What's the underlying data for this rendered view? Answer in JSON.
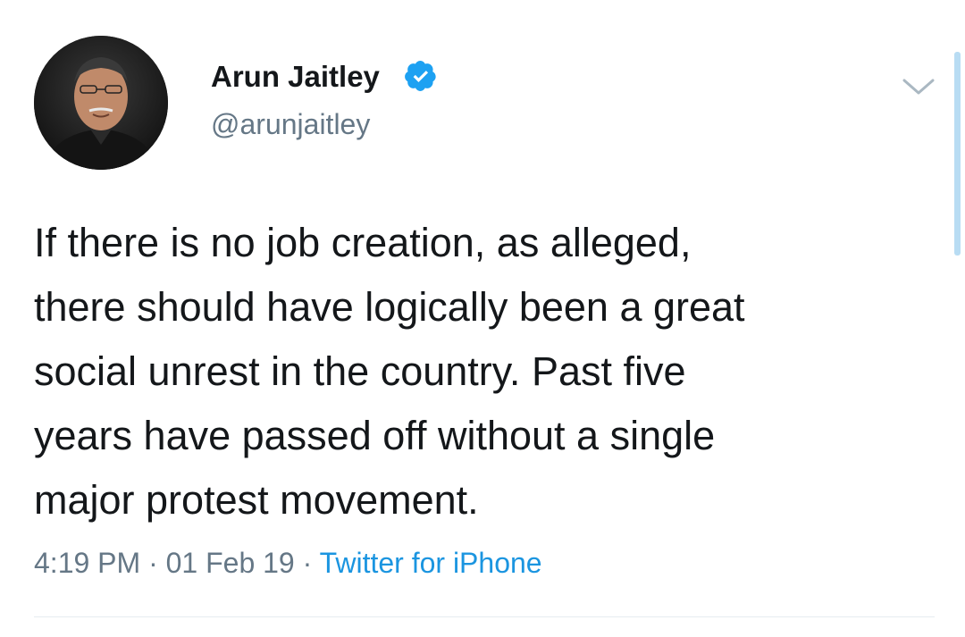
{
  "tweet": {
    "author": {
      "display_name": "Arun Jaitley",
      "handle": "@arunjaitley",
      "verified": true
    },
    "text": "If there is no job creation, as alleged,\nthere should have logically been a great\nsocial unrest in the country. Past five\nyears have passed off without a single\nmajor protest movement.",
    "time": "4:19 PM",
    "separator": " · ",
    "date": "01 Feb 19",
    "source": "Twitter for iPhone"
  },
  "icons": {
    "verified": "verified-badge-icon",
    "menu": "chevron-down-icon"
  },
  "colors": {
    "text": "#14171a",
    "secondary": "#657786",
    "accent": "#1da1f2",
    "link": "#1b95e0",
    "divider": "#e6ecf0"
  }
}
